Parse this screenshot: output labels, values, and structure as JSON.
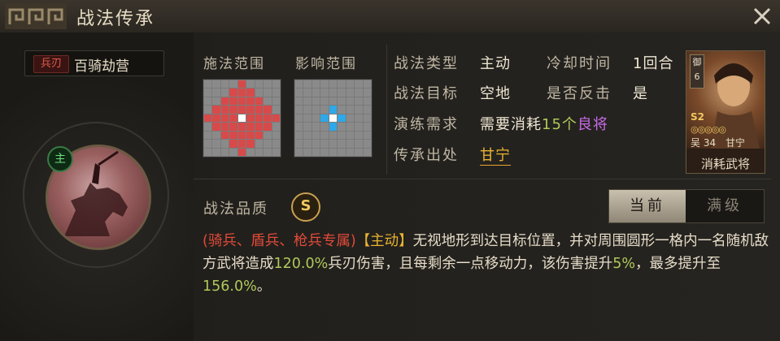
{
  "header": {
    "title": "战法传承"
  },
  "skill": {
    "type_badge": "兵刃",
    "name": "百骑劫营",
    "role_badge": "主"
  },
  "range": {
    "cast_label": "施法范围",
    "effect_label": "影响范围"
  },
  "stats": {
    "type_label": "战法类型",
    "type_value": "主动",
    "cooldown_label": "冷却时间",
    "cooldown_value": "1回合",
    "target_label": "战法目标",
    "target_value": "空地",
    "counter_label": "是否反击",
    "counter_value": "是",
    "drill_label": "演练需求",
    "drill_prefix": "需要消耗",
    "drill_count": "15个",
    "drill_item": "良将",
    "origin_label": "传承出处",
    "origin_value": "甘宁"
  },
  "hero": {
    "corner_badge": "御",
    "corner_num": "6",
    "season": "S2",
    "faction": "吴",
    "cost": "34",
    "short_name": "甘宁",
    "consume_label": "消耗武将"
  },
  "quality": {
    "label": "战法品质",
    "grade": "S"
  },
  "tabs": {
    "current": "当前",
    "max": "满级"
  },
  "description": {
    "restriction": "(骑兵、盾兵、枪兵专属)",
    "tag": "【主动】",
    "text1": "无视地形到达目标位置，并对周围圆形一格内一名随机敌方武将造成",
    "pct1": "120.0%",
    "text2": "兵刃伤害，且每剩余一点移动力，该伤害提升",
    "pct2": "5%",
    "text3": "，最多提升至",
    "pct3": "156.0%",
    "text4": "。"
  },
  "colors": {
    "cast_range": "#d84a4a",
    "effect_range": "#2ea8e6",
    "highlight": "#e8b432",
    "purple": "#c86ae8"
  }
}
